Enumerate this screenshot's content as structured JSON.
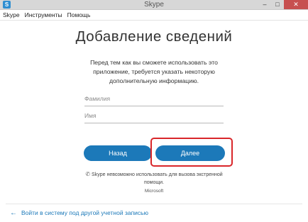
{
  "window": {
    "title": "Skype",
    "app_icon_letter": "S"
  },
  "menu": {
    "items": [
      "Skype",
      "Инструменты",
      "Помощь"
    ]
  },
  "main": {
    "heading": "Добавление сведений",
    "description": "Перед тем как вы сможете использовать это приложение, требуется указать некоторую дополнительную информацию.",
    "last_name_placeholder": "Фамилия",
    "first_name_placeholder": "Имя",
    "back_label": "Назад",
    "next_label": "Далее",
    "emergency_notice": "Skype невозможно использовать для вызова экстренной помощи.",
    "brand": "Microsoft"
  },
  "footer": {
    "signin_other": "Войти в систему под другой учетной записью"
  },
  "colors": {
    "accent": "#1c79b9",
    "highlight": "#d9262a",
    "close": "#c75050"
  },
  "icons": {
    "emergency": "phone-crossed-icon",
    "back_arrow": "arrow-left-icon"
  }
}
